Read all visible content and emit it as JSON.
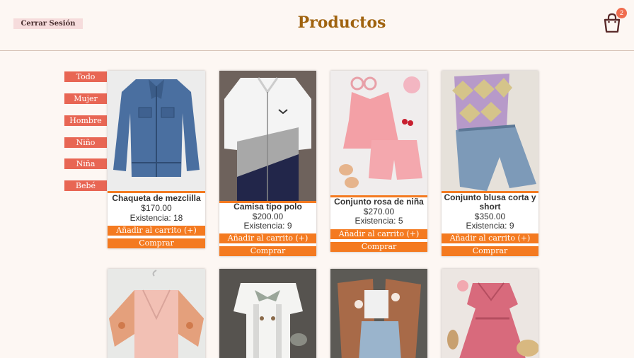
{
  "header": {
    "logout_label": "Cerrar Sesión",
    "title": "Productos",
    "cart_count": "2"
  },
  "categories": [
    "Todo",
    "Mujer",
    "Hombre",
    "Niño",
    "Niña",
    "Bebé"
  ],
  "products": [
    {
      "name": "Chaqueta de mezclilla",
      "price": "$170.00",
      "stock": "Existencia: 18",
      "add_label": "Añadir al carrito (+)",
      "buy_label": "Comprar"
    },
    {
      "name": "Camisa tipo polo",
      "price": "$200.00",
      "stock": "Existencia: 9",
      "add_label": "Añadir al carrito (+)",
      "buy_label": "Comprar"
    },
    {
      "name": "Conjunto rosa de niña",
      "price": "$270.00",
      "stock": "Existencia: 5",
      "add_label": "Añadir al carrito (+)",
      "buy_label": "Comprar"
    },
    {
      "name": "Conjunto blusa corta y short",
      "price": "$350.00",
      "stock": "Existencia: 9",
      "add_label": "Añadir al carrito (+)",
      "buy_label": "Comprar"
    }
  ],
  "colors": {
    "accent": "#f47a20",
    "category": "#e86654",
    "title": "#a0630f",
    "badge": "#f06d4f"
  }
}
